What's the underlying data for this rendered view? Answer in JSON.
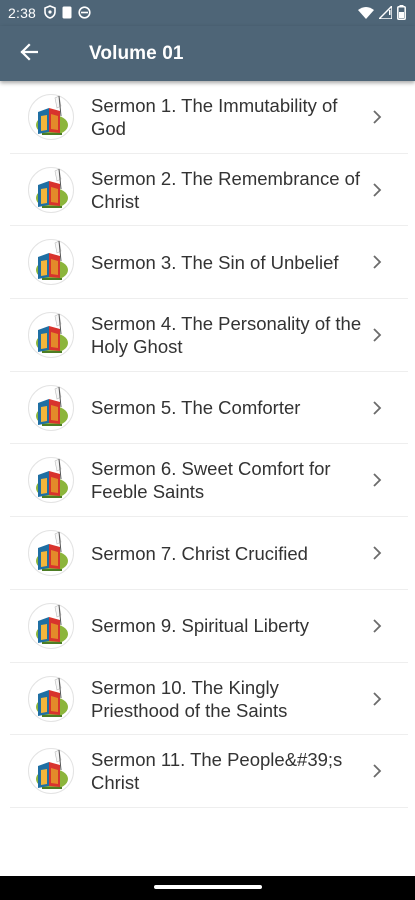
{
  "status_bar": {
    "time": "2:38",
    "left_icons": [
      "shield-check-icon",
      "document-icon",
      "sync-icon"
    ],
    "right_icons": [
      "wifi-icon",
      "signal-icon",
      "battery-icon"
    ]
  },
  "app_bar": {
    "title": "Volume 01",
    "background": "#4e6577"
  },
  "sermons": [
    {
      "label": "Sermon 1. The Immutability of God"
    },
    {
      "label": "Sermon 2. The Remembrance of Christ"
    },
    {
      "label": "Sermon 3. The Sin of Unbelief"
    },
    {
      "label": "Sermon 4. The Personality of the Holy Ghost"
    },
    {
      "label": "Sermon 5. The Comforter"
    },
    {
      "label": "Sermon 6. Sweet Comfort for Feeble Saints"
    },
    {
      "label": "Sermon 7. Christ Crucified"
    },
    {
      "label": "Sermon 9. Spiritual Liberty"
    },
    {
      "label": "Sermon 10. The Kingly Priesthood of the Saints"
    },
    {
      "label": "Sermon 11. The People&#39;s Christ"
    }
  ]
}
